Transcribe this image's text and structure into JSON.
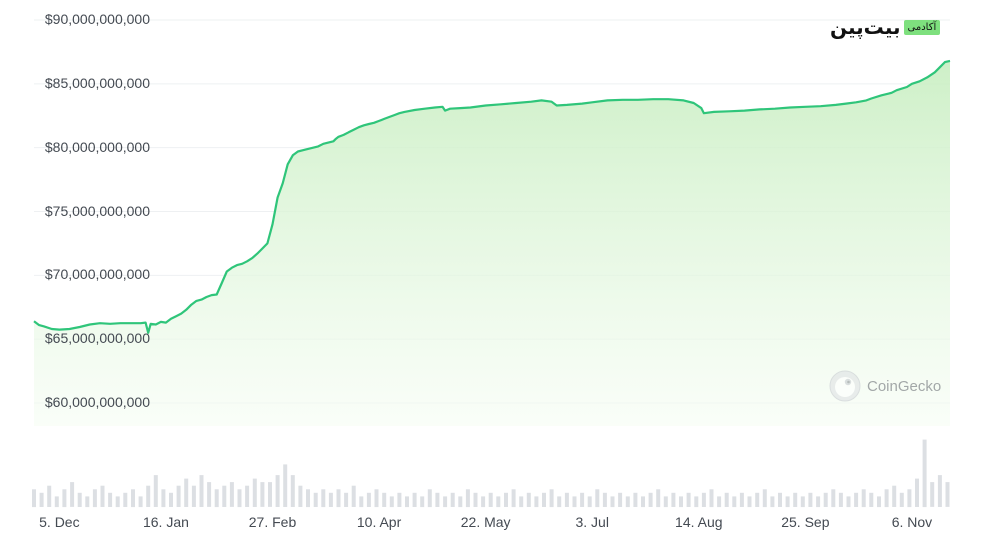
{
  "brand": {
    "name": "بیت‌پین",
    "tag": "آکادمی"
  },
  "watermark": {
    "name": "CoinGecko",
    "icon": "gecko-icon"
  },
  "colors": {
    "line": "#2fc57a",
    "fill_top": "#c8eec1",
    "fill_bottom": "#f6fdf4",
    "volume": "#dcdfe3",
    "grid": "#eef0f2"
  },
  "chart_data": {
    "type": "area",
    "title": "",
    "xlabel": "",
    "ylabel": "",
    "ylim": [
      57500000000,
      90000000000
    ],
    "grid": true,
    "y_ticks": [
      "$90,000,000,000",
      "$85,000,000,000",
      "$80,000,000,000",
      "$75,000,000,000",
      "$70,000,000,000",
      "$65,000,000,000",
      "$60,000,000,000"
    ],
    "y_tick_values": [
      90000000000,
      85000000000,
      80000000000,
      75000000000,
      70000000000,
      65000000000,
      60000000000
    ],
    "x_ticks": [
      "5. Dec",
      "16. Jan",
      "27. Feb",
      "10. Apr",
      "22. May",
      "3. Jul",
      "14. Aug",
      "25. Sep",
      "6. Nov"
    ],
    "x_tick_days": [
      10,
      52,
      94,
      136,
      178,
      220,
      262,
      304,
      346
    ],
    "x_range_days": [
      0,
      361
    ],
    "series": [
      {
        "days": [
          0,
          2,
          4,
          7,
          10,
          14,
          18,
          22,
          26,
          30,
          34,
          38,
          42,
          44,
          45,
          46,
          48,
          50,
          52,
          54,
          56,
          58,
          60,
          62,
          64,
          66,
          68,
          70,
          72,
          74,
          76,
          78,
          80,
          82,
          84,
          86,
          88,
          90,
          92,
          94,
          96,
          98,
          100,
          102,
          104,
          106,
          108,
          110,
          112,
          114,
          116,
          118,
          119,
          120,
          122,
          124,
          126,
          128,
          130,
          132,
          134,
          136,
          138,
          140,
          142,
          144,
          146,
          150,
          154,
          158,
          161,
          162,
          164,
          168,
          172,
          178,
          184,
          190,
          196,
          200,
          204,
          206,
          210,
          216,
          220,
          226,
          232,
          238,
          244,
          250,
          256,
          260,
          263,
          264,
          268,
          274,
          280,
          286,
          292,
          298,
          304,
          310,
          316,
          320,
          324,
          328,
          330,
          334,
          338,
          340,
          344,
          346,
          349,
          352,
          355,
          357,
          359,
          361
        ],
        "values": [
          66400000000,
          66100000000,
          66000000000,
          65800000000,
          65750000000,
          65800000000,
          65950000000,
          66150000000,
          66250000000,
          66200000000,
          66250000000,
          66250000000,
          66250000000,
          66300000000,
          65500000000,
          66200000000,
          66150000000,
          66350000000,
          66300000000,
          66600000000,
          66800000000,
          67000000000,
          67300000000,
          67700000000,
          68000000000,
          68100000000,
          68300000000,
          68450000000,
          68500000000,
          69400000000,
          70300000000,
          70600000000,
          70800000000,
          70900000000,
          71100000000,
          71350000000,
          71700000000,
          72100000000,
          72500000000,
          74000000000,
          76100000000,
          77200000000,
          78700000000,
          79400000000,
          79700000000,
          79800000000,
          79900000000,
          80000000000,
          80100000000,
          80300000000,
          80400000000,
          80500000000,
          80700000000,
          80850000000,
          81000000000,
          81200000000,
          81400000000,
          81600000000,
          81750000000,
          81850000000,
          81950000000,
          82100000000,
          82250000000,
          82400000000,
          82550000000,
          82700000000,
          82800000000,
          82950000000,
          83050000000,
          83150000000,
          83200000000,
          82900000000,
          83050000000,
          83100000000,
          83150000000,
          83300000000,
          83400000000,
          83500000000,
          83600000000,
          83700000000,
          83600000000,
          83300000000,
          83350000000,
          83450000000,
          83550000000,
          83700000000,
          83750000000,
          83750000000,
          83800000000,
          83800000000,
          83700000000,
          83500000000,
          83100000000,
          82700000000,
          82800000000,
          82850000000,
          82900000000,
          83000000000,
          83050000000,
          83150000000,
          83200000000,
          83250000000,
          83350000000,
          83450000000,
          83550000000,
          83700000000,
          83850000000,
          84100000000,
          84300000000,
          84500000000,
          84750000000,
          85000000000,
          85200000000,
          85500000000,
          85900000000,
          86300000000,
          86700000000,
          86800000000
        ]
      }
    ],
    "volume": {
      "days": [
        0,
        3,
        6,
        9,
        12,
        15,
        18,
        21,
        24,
        27,
        30,
        33,
        36,
        39,
        42,
        45,
        48,
        51,
        54,
        57,
        60,
        63,
        66,
        69,
        72,
        75,
        78,
        81,
        84,
        87,
        90,
        93,
        96,
        99,
        102,
        105,
        108,
        111,
        114,
        117,
        120,
        123,
        126,
        129,
        132,
        135,
        138,
        141,
        144,
        147,
        150,
        153,
        156,
        159,
        162,
        165,
        168,
        171,
        174,
        177,
        180,
        183,
        186,
        189,
        192,
        195,
        198,
        201,
        204,
        207,
        210,
        213,
        216,
        219,
        222,
        225,
        228,
        231,
        234,
        237,
        240,
        243,
        246,
        249,
        252,
        255,
        258,
        261,
        264,
        267,
        270,
        273,
        276,
        279,
        282,
        285,
        288,
        291,
        294,
        297,
        300,
        303,
        306,
        309,
        312,
        315,
        318,
        321,
        324,
        327,
        330,
        333,
        336,
        339,
        342,
        345,
        348,
        351,
        354,
        357,
        360
      ],
      "values": [
        0.25,
        0.2,
        0.3,
        0.15,
        0.25,
        0.35,
        0.2,
        0.15,
        0.25,
        0.3,
        0.2,
        0.15,
        0.2,
        0.25,
        0.15,
        0.3,
        0.45,
        0.25,
        0.2,
        0.3,
        0.4,
        0.3,
        0.45,
        0.35,
        0.25,
        0.3,
        0.35,
        0.25,
        0.3,
        0.4,
        0.35,
        0.35,
        0.45,
        0.6,
        0.45,
        0.3,
        0.25,
        0.2,
        0.25,
        0.2,
        0.25,
        0.2,
        0.3,
        0.15,
        0.2,
        0.25,
        0.2,
        0.15,
        0.2,
        0.15,
        0.2,
        0.15,
        0.25,
        0.2,
        0.15,
        0.2,
        0.15,
        0.25,
        0.2,
        0.15,
        0.2,
        0.15,
        0.2,
        0.25,
        0.15,
        0.2,
        0.15,
        0.2,
        0.25,
        0.15,
        0.2,
        0.15,
        0.2,
        0.15,
        0.25,
        0.2,
        0.15,
        0.2,
        0.15,
        0.2,
        0.15,
        0.2,
        0.25,
        0.15,
        0.2,
        0.15,
        0.2,
        0.15,
        0.2,
        0.25,
        0.15,
        0.2,
        0.15,
        0.2,
        0.15,
        0.2,
        0.25,
        0.15,
        0.2,
        0.15,
        0.2,
        0.15,
        0.2,
        0.15,
        0.2,
        0.25,
        0.2,
        0.15,
        0.2,
        0.25,
        0.2,
        0.15,
        0.25,
        0.3,
        0.2,
        0.25,
        0.4,
        0.95,
        0.35,
        0.45,
        0.35
      ]
    }
  }
}
